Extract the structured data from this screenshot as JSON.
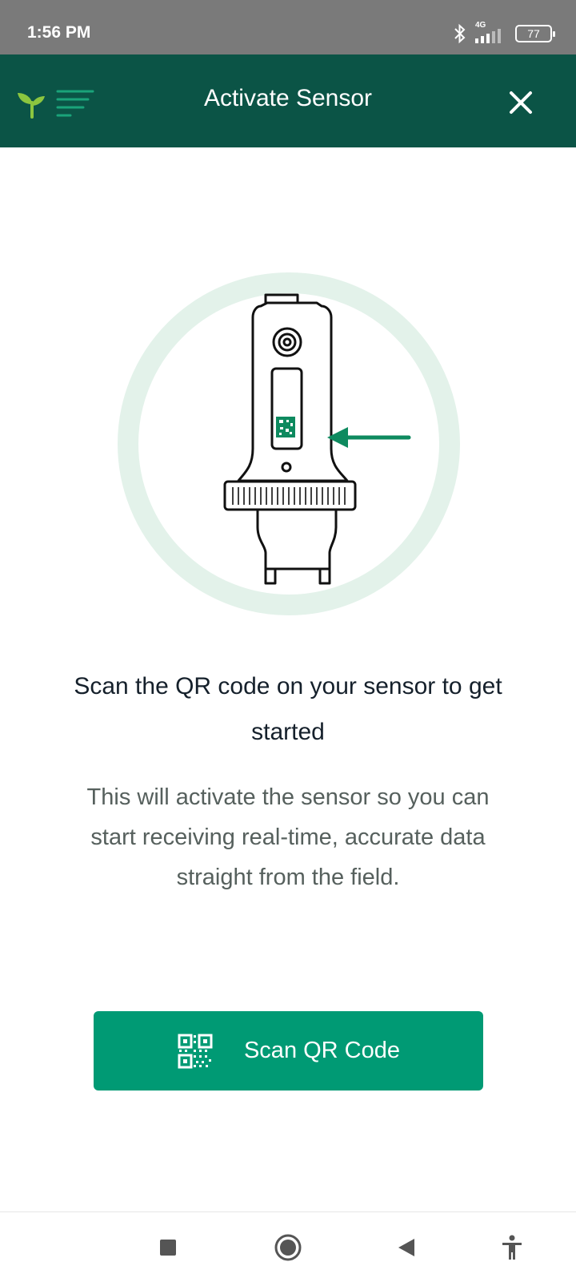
{
  "status_bar": {
    "time": "1:56 PM",
    "network": "4G",
    "battery": "77"
  },
  "header": {
    "title": "Activate Sensor",
    "logo_icon": "sprout-logo-icon",
    "menu_icon": "menu-icon",
    "close_icon": "close-icon",
    "background_color": "#0b5446"
  },
  "illustration": {
    "icon": "sensor-qr-illustration",
    "ring_color": "#e3f2ea",
    "arrow_color": "#0e8a5f"
  },
  "content": {
    "headline": "Scan the QR code on your sensor to get started",
    "body": "This will activate the sensor so you can start receiving real-time, accurate data straight from the field."
  },
  "scan_button": {
    "label": "Scan QR Code",
    "icon": "qr-code-icon",
    "color": "#009a74"
  },
  "nav_bar": {
    "recents_icon": "square-icon",
    "home_icon": "circle-icon",
    "back_icon": "back-triangle-icon",
    "accessibility_icon": "accessibility-icon"
  }
}
